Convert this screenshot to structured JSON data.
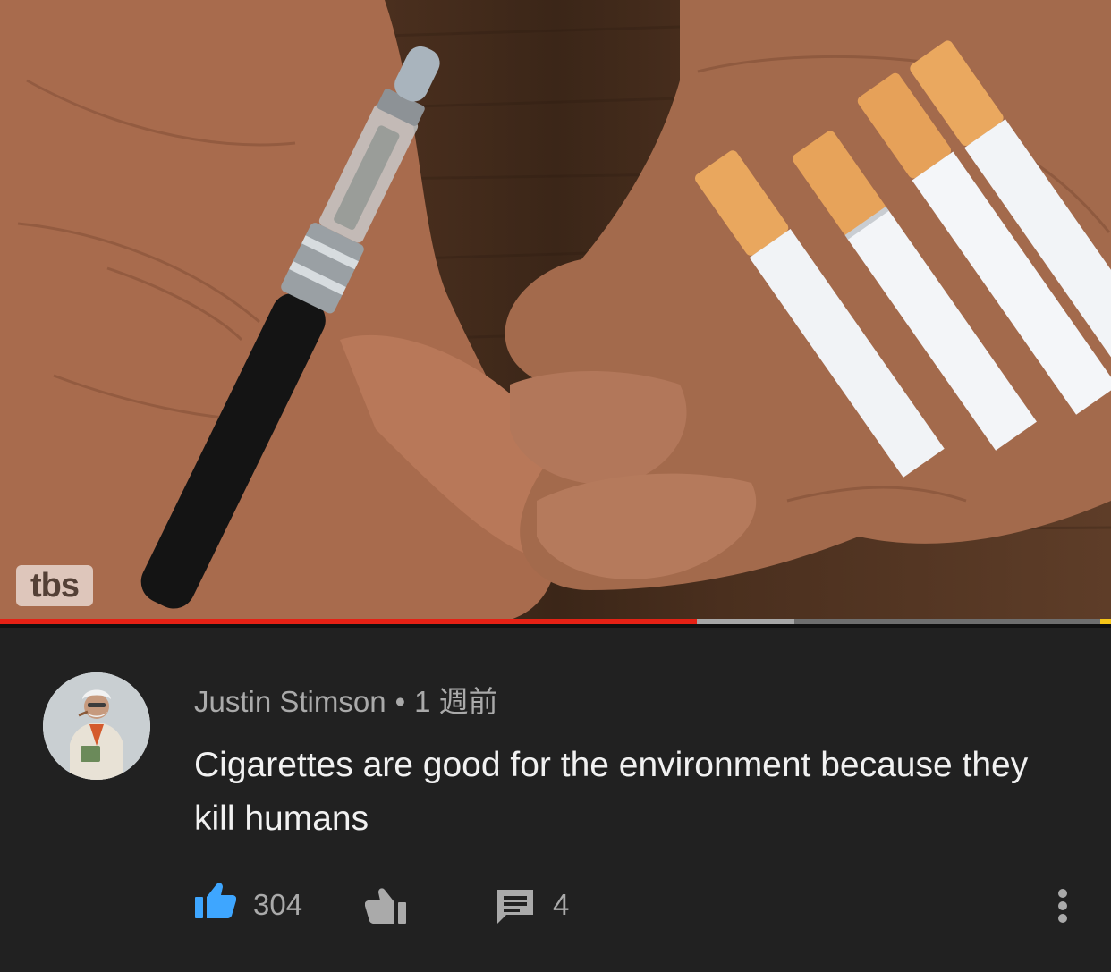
{
  "video": {
    "watermark": "tbs",
    "progress_played": 0.627,
    "progress_buffered": 0.715
  },
  "comment": {
    "author": "Justin Stimson",
    "separator": "•",
    "timestamp": "1 週前",
    "text": "Cigarettes are good for the environment because they kill humans",
    "like_count": "304",
    "reply_count": "4",
    "icons": {
      "like": "thumbs-up-icon",
      "dislike": "thumbs-down-icon",
      "reply": "comment-icon",
      "more": "more-vertical-icon"
    }
  },
  "colors": {
    "background": "#212121",
    "progress_played": "#e52115",
    "like_active": "#3ea6ff",
    "secondary_text": "#aaaaaa",
    "primary_text": "#f1f1f1"
  }
}
